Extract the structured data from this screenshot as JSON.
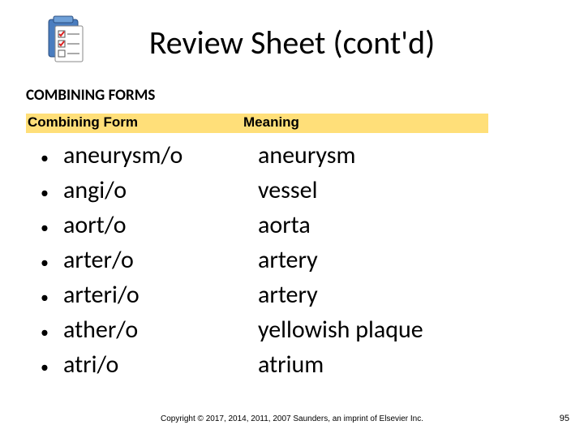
{
  "title": "Review Sheet (cont'd)",
  "subheading": "COMBINING FORMS",
  "columns": {
    "left": "Combining Form",
    "right": "Meaning"
  },
  "rows": [
    {
      "term": "aneurysm/o",
      "meaning": "aneurysm"
    },
    {
      "term": "angi/o",
      "meaning": "vessel"
    },
    {
      "term": "aort/o",
      "meaning": "aorta"
    },
    {
      "term": "arter/o",
      "meaning": "artery"
    },
    {
      "term": "arteri/o",
      "meaning": "artery"
    },
    {
      "term": "ather/o",
      "meaning": "yellowish plaque"
    },
    {
      "term": "atri/o",
      "meaning": "atrium"
    }
  ],
  "copyright": "Copyright © 2017, 2014, 2011, 2007 Saunders, an imprint of Elsevier Inc.",
  "page_number": "95",
  "icon_name": "checklist-clipboard-icon"
}
